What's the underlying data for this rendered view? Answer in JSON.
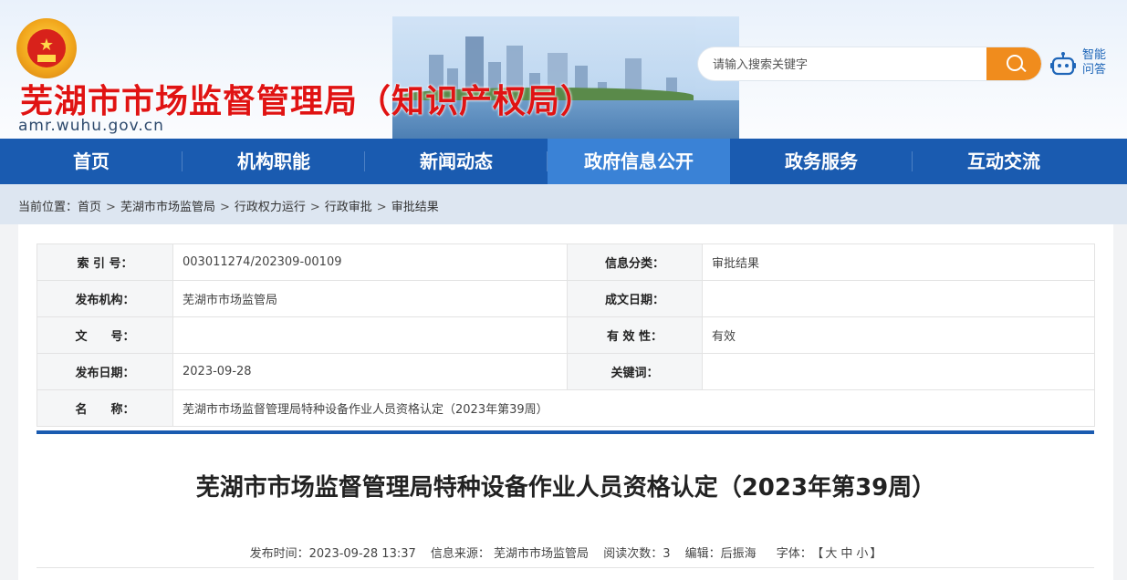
{
  "header": {
    "title": "芜湖市市场监督管理局（知识产权局）",
    "url": "amr.wuhu.gov.cn",
    "search_placeholder": "请输入搜索关键字",
    "robot_label": "智能问答"
  },
  "nav": {
    "items": [
      {
        "label": "首页"
      },
      {
        "label": "机构职能"
      },
      {
        "label": "新闻动态"
      },
      {
        "label": "政府信息公开"
      },
      {
        "label": "政务服务"
      },
      {
        "label": "互动交流"
      }
    ],
    "active_index": 3
  },
  "breadcrumb": {
    "prefix": "当前位置：",
    "items": [
      "首页",
      "芜湖市市场监管局",
      "行政权力运行",
      "行政审批",
      "审批结果"
    ],
    "separator": ">"
  },
  "meta": {
    "index_label": "索 引 号：",
    "index_value": "003011274/202309-00109",
    "category_label": "信息分类：",
    "category_value": "审批结果",
    "publisher_label": "发布机构：",
    "publisher_value": "芜湖市市场监管局",
    "created_label": "成文日期：",
    "created_value": "",
    "docno_label": "文　　号：",
    "docno_value": "",
    "validity_label": "有 效 性：",
    "validity_value": "有效",
    "pubdate_label": "发布日期：",
    "pubdate_value": "2023-09-28",
    "keywords_label": "关键词：",
    "keywords_value": "",
    "name_label": "名　　称：",
    "name_value": "芜湖市市场监督管理局特种设备作业人员资格认定（2023年第39周）"
  },
  "article": {
    "title": "芜湖市市场监督管理局特种设备作业人员资格认定（2023年第39周）",
    "publish_time": "发布时间：2023-09-28 13:37",
    "source": "信息来源： 芜湖市市场监管局",
    "views": "阅读次数：3",
    "editor": "编辑：后振海",
    "font_label": "字体：",
    "font_open": "【",
    "font_large": "大",
    "font_medium": "中",
    "font_small": "小",
    "font_close": "】"
  },
  "colors": {
    "nav_bg": "#1a5bb0",
    "nav_active": "#3a82d6",
    "title_red": "#e01313",
    "search_orange": "#f08c1d"
  }
}
